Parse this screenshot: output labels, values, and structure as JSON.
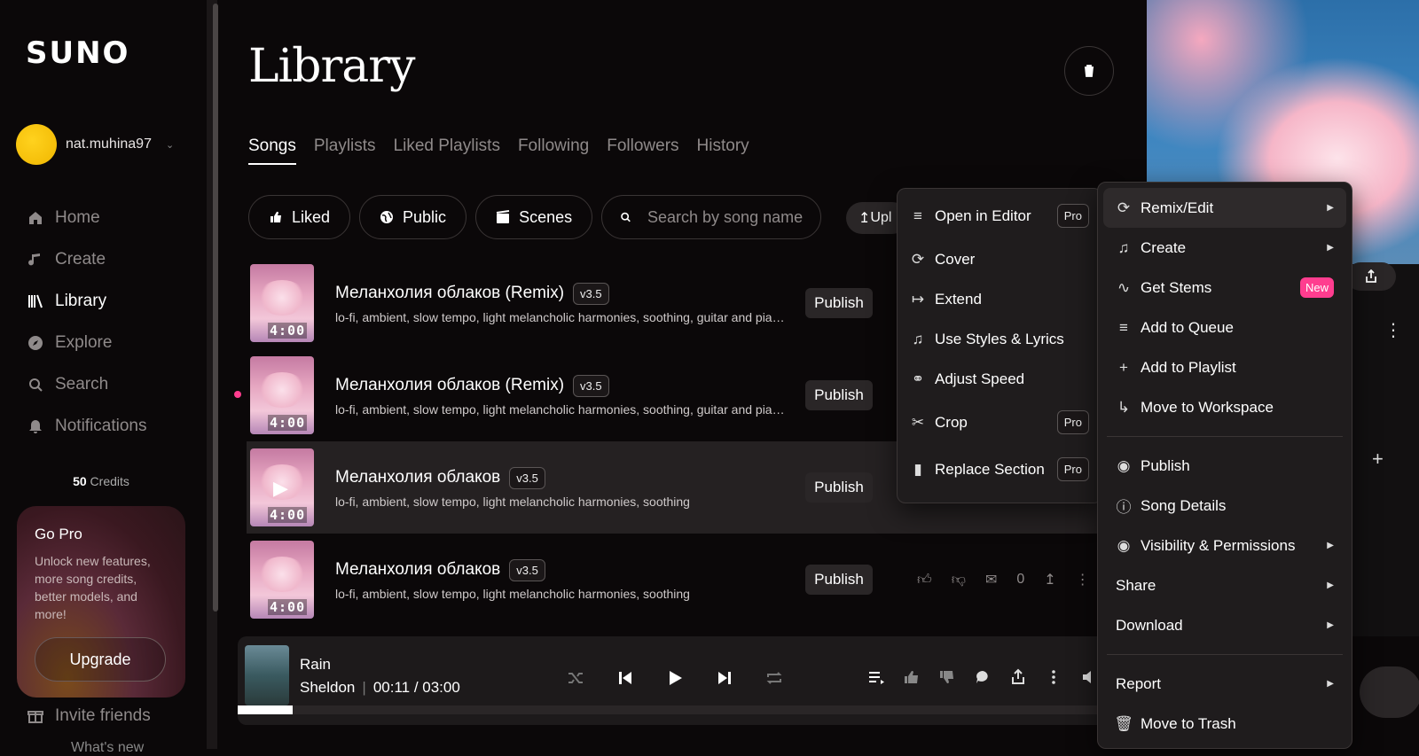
{
  "app": {
    "logo": "SUNO"
  },
  "user": {
    "name": "nat.muhina97"
  },
  "nav": [
    {
      "label": "Home",
      "icon": "home-icon"
    },
    {
      "label": "Create",
      "icon": "music-note-icon"
    },
    {
      "label": "Library",
      "icon": "library-icon"
    },
    {
      "label": "Explore",
      "icon": "compass-icon"
    },
    {
      "label": "Search",
      "icon": "search-icon"
    },
    {
      "label": "Notifications",
      "icon": "bell-icon"
    }
  ],
  "credits": {
    "amount": "50",
    "label": "Credits"
  },
  "gopro": {
    "title": "Go Pro",
    "text": "Unlock new features, more song credits, better models, and more!",
    "button": "Upgrade"
  },
  "invite": "Invite friends",
  "whats_new": "What's new",
  "page": {
    "title": "Library"
  },
  "tabs": [
    "Songs",
    "Playlists",
    "Liked Playlists",
    "Following",
    "Followers",
    "History"
  ],
  "filters": {
    "liked": "Liked",
    "public": "Public",
    "scenes": "Scenes",
    "search_placeholder": "Search by song name",
    "upload": "Upl"
  },
  "songs": [
    {
      "title": "Меланхолия облаков (Remix)",
      "version": "v3.5",
      "tags": "lo-fi, ambient, slow tempo, light melancholic harmonies, soothing, guitar and pian...",
      "duration": "4:00",
      "publish": "Publish"
    },
    {
      "title": "Меланхолия облаков (Remix)",
      "version": "v3.5",
      "tags": "lo-fi, ambient, slow tempo, light melancholic harmonies, soothing, guitar and pian...",
      "duration": "4:00",
      "publish": "Publish"
    },
    {
      "title": "Меланхолия облаков",
      "version": "v3.5",
      "tags": "lo-fi, ambient, slow tempo, light melancholic harmonies, soothing",
      "duration": "4:00",
      "publish": "Publish"
    },
    {
      "title": "Меланхолия облаков",
      "version": "v3.5",
      "tags": "lo-fi, ambient, slow tempo, light melancholic harmonies, soothing",
      "duration": "4:00",
      "publish": "Publish",
      "comments": "0"
    }
  ],
  "player": {
    "title": "Rain",
    "artist": "Sheldon",
    "time": "00:11 / 03:00",
    "progress": 0.061
  },
  "submenu": [
    {
      "label": "Open in Editor",
      "badge": "Pro"
    },
    {
      "label": "Cover"
    },
    {
      "label": "Extend"
    },
    {
      "label": "Use Styles & Lyrics"
    },
    {
      "label": "Adjust Speed"
    },
    {
      "label": "Crop",
      "badge": "Pro"
    },
    {
      "label": "Replace Section",
      "badge": "Pro"
    }
  ],
  "menu": {
    "remix_edit": "Remix/Edit",
    "create": "Create",
    "get_stems": "Get Stems",
    "new_badge": "New",
    "add_queue": "Add to Queue",
    "add_playlist": "Add to Playlist",
    "move_workspace": "Move to Workspace",
    "publish": "Publish",
    "song_details": "Song Details",
    "visibility": "Visibility & Permissions",
    "share": "Share",
    "download": "Download",
    "report": "Report",
    "trash": "Move to Trash"
  },
  "colors": {
    "accent_pink": "#ff3d8f",
    "background": "#0b0809"
  }
}
